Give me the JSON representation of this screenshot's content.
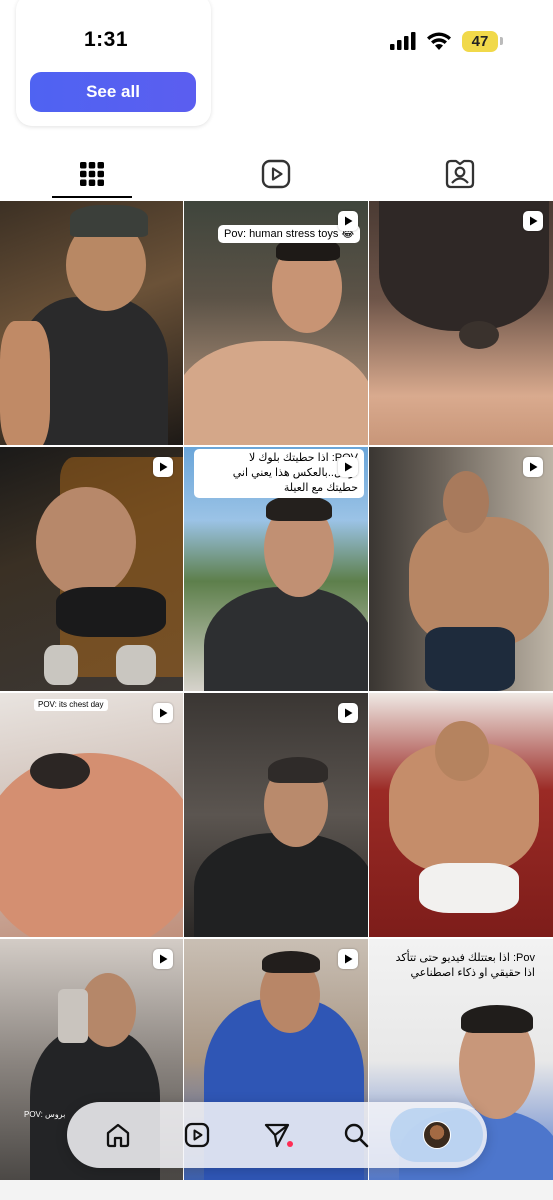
{
  "status_bar": {
    "time": "1:31",
    "battery": "47"
  },
  "suggestion_card": {
    "see_all_label": "See all"
  },
  "tabs": [
    {
      "name": "posts",
      "icon": "grid-icon",
      "active": true
    },
    {
      "name": "reels",
      "icon": "reels-icon",
      "active": false
    },
    {
      "name": "tagged",
      "icon": "tagged-icon",
      "active": false
    }
  ],
  "grid": [
    {
      "caption": "",
      "reel": false
    },
    {
      "caption": "Pov: human stress toys 😂",
      "reel": true
    },
    {
      "caption": "",
      "reel": true
    },
    {
      "caption": "",
      "reel": true
    },
    {
      "caption": "POV: اذا حطيتك بلوك لا تزعل..بالعكس هذا يعني اني حطيتك مع العيلة",
      "reel": true
    },
    {
      "caption": "",
      "reel": true
    },
    {
      "caption": "POV: its chest day",
      "reel": true
    },
    {
      "caption": "",
      "reel": true
    },
    {
      "caption": "",
      "reel": false
    },
    {
      "caption": "POV: بروس",
      "reel": true
    },
    {
      "caption": "",
      "reel": true
    },
    {
      "caption": "Pov: اذا بعتتلك فيديو حتى تتأكد اذا حقيقي او ذكاء اصطناعي",
      "reel": true
    }
  ],
  "bottom_nav": [
    {
      "name": "home",
      "icon": "home-icon"
    },
    {
      "name": "reels",
      "icon": "reels-icon"
    },
    {
      "name": "messages",
      "icon": "send-icon"
    },
    {
      "name": "search",
      "icon": "search-icon"
    },
    {
      "name": "profile",
      "icon": "avatar"
    }
  ],
  "colors": {
    "accent_button": "#4f63f2",
    "battery": "#f1d94a",
    "notification_dot": "#ff2d55"
  }
}
